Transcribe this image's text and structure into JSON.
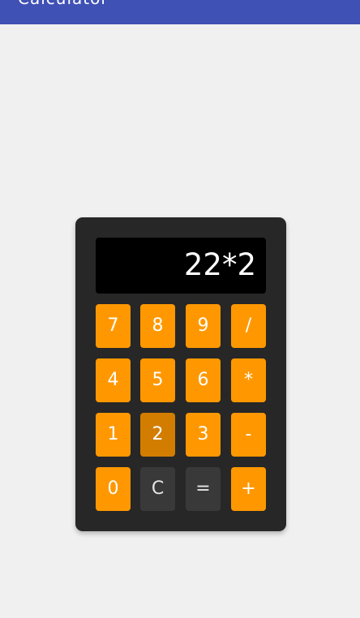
{
  "app_bar": {
    "title": "Calculator",
    "color": "#3f51b5"
  },
  "display": {
    "value": "22*2"
  },
  "keys": [
    {
      "label": "7",
      "style": "orange"
    },
    {
      "label": "8",
      "style": "orange"
    },
    {
      "label": "9",
      "style": "orange"
    },
    {
      "label": "/",
      "style": "orange"
    },
    {
      "label": "4",
      "style": "orange"
    },
    {
      "label": "5",
      "style": "orange"
    },
    {
      "label": "6",
      "style": "orange"
    },
    {
      "label": "*",
      "style": "orange"
    },
    {
      "label": "1",
      "style": "orange"
    },
    {
      "label": "2",
      "style": "pressed"
    },
    {
      "label": "3",
      "style": "orange"
    },
    {
      "label": "-",
      "style": "orange"
    },
    {
      "label": "0",
      "style": "orange"
    },
    {
      "label": "C",
      "style": "dark"
    },
    {
      "label": "=",
      "style": "dark"
    },
    {
      "label": "+",
      "style": "orange"
    }
  ],
  "colors": {
    "key_orange": "#ff9800",
    "key_pressed": "#d27d00",
    "key_dark": "#393939",
    "panel": "#272727",
    "display_bg": "#000000",
    "background": "#f0f0f0"
  }
}
